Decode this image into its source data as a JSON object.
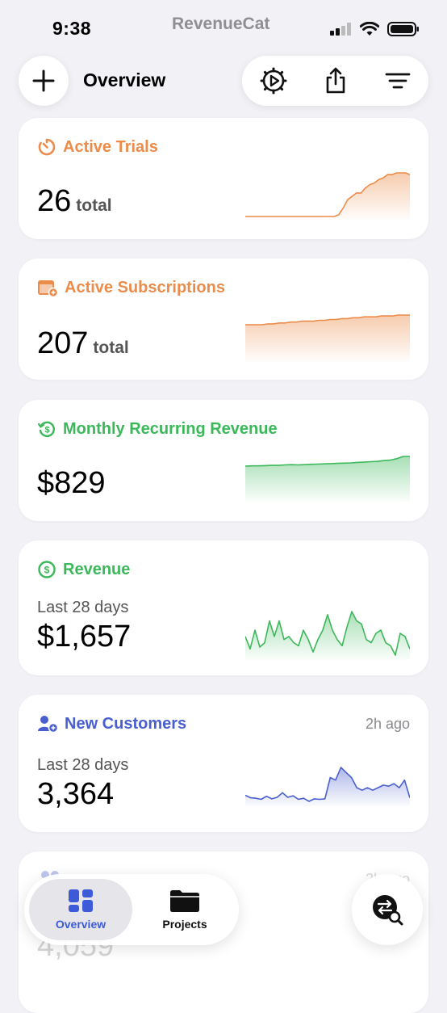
{
  "status": {
    "time": "9:38",
    "carrier": "RevenueCat"
  },
  "header": {
    "title": "Overview"
  },
  "cards": [
    {
      "title": "Active Trials",
      "value": "26",
      "unit": "total",
      "color": "#eb8c4a",
      "series": [
        0,
        0,
        0,
        0,
        0,
        0,
        0,
        0,
        0,
        0,
        0,
        0,
        0,
        0,
        0,
        0,
        0,
        0,
        0,
        0,
        0,
        1,
        5,
        10,
        12,
        14,
        14,
        17,
        19,
        20,
        22,
        23,
        25,
        25,
        26,
        26,
        26,
        25
      ]
    },
    {
      "title": "Active Subscriptions",
      "value": "207",
      "unit": "total",
      "color": "#eb8c4a",
      "series": [
        196,
        196,
        196,
        196,
        197,
        197,
        198,
        198,
        199,
        199,
        200,
        200,
        200,
        201,
        201,
        202,
        202,
        203,
        203,
        204,
        204,
        205,
        205,
        205,
        206,
        206,
        206,
        207,
        207,
        207
      ]
    },
    {
      "title": "Monthly Recurring Revenue",
      "value": "$829",
      "unit": "",
      "color": "#3cb85a",
      "series": [
        790,
        791,
        791,
        792,
        793,
        793,
        795,
        796,
        795,
        796,
        797,
        798,
        799,
        800,
        801,
        802,
        803,
        805,
        806,
        808,
        809,
        812,
        814,
        820,
        829,
        829
      ]
    },
    {
      "title": "Revenue",
      "subtitle": "Last 28 days",
      "value": "$1,657",
      "unit": "",
      "color": "#3cb85a",
      "series": [
        45,
        25,
        55,
        28,
        35,
        70,
        45,
        70,
        40,
        45,
        35,
        30,
        55,
        40,
        20,
        40,
        55,
        80,
        55,
        40,
        30,
        60,
        85,
        70,
        65,
        40,
        35,
        50,
        55,
        35,
        30,
        15,
        50,
        45,
        25
      ]
    },
    {
      "title": "New Customers",
      "subtitle": "Last 28 days",
      "ago": "2h ago",
      "value": "3,364",
      "unit": "",
      "color": "#4a5fcf",
      "series": [
        110,
        105,
        104,
        102,
        108,
        103,
        106,
        115,
        106,
        109,
        102,
        104,
        98,
        103,
        102,
        103,
        145,
        140,
        165,
        155,
        145,
        125,
        120,
        125,
        120,
        125,
        130,
        128,
        133,
        125,
        140,
        105
      ]
    }
  ],
  "hidden_card": {
    "value": "4,059",
    "ago": "2h ago"
  },
  "tabs": {
    "overview": "Overview",
    "projects": "Projects"
  }
}
